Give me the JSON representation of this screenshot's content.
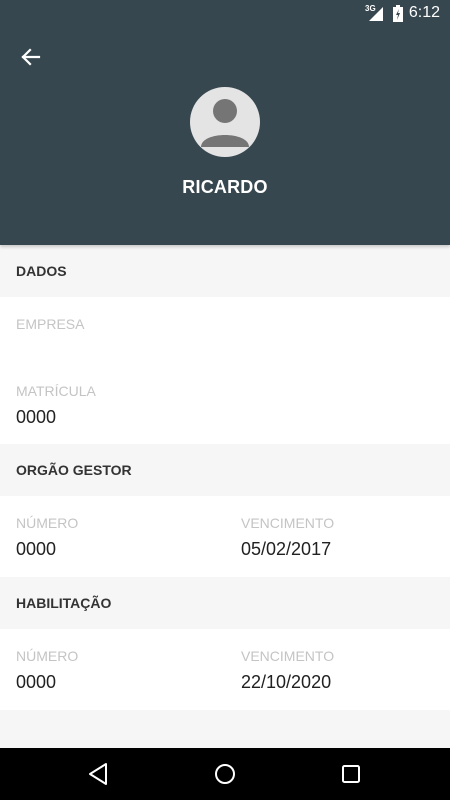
{
  "status_bar": {
    "network": "3G",
    "time": "6:12"
  },
  "header": {
    "back_icon": "arrow-left-icon",
    "avatar_icon": "person-icon",
    "name": "RICARDO",
    "background_color": "#37474f"
  },
  "sections": {
    "dados": {
      "title": "DADOS",
      "empresa_label": "EMPRESA",
      "empresa_value": "",
      "matricula_label": "MATRÍCULA",
      "matricula_value": "0000"
    },
    "orgao_gestor": {
      "title": "ORGÃO GESTOR",
      "numero_label": "NÚMERO",
      "numero_value": "0000",
      "vencimento_label": "VENCIMENTO",
      "vencimento_value": "05/02/2017"
    },
    "habilitacao": {
      "title": "HABILITAÇÃO",
      "numero_label": "NÚMERO",
      "numero_value": "0000",
      "vencimento_label": "VENCIMENTO",
      "vencimento_value": "22/10/2020"
    }
  },
  "nav_bar": {
    "back_icon": "triangle-back-icon",
    "home_icon": "circle-home-icon",
    "recents_icon": "square-recents-icon"
  }
}
